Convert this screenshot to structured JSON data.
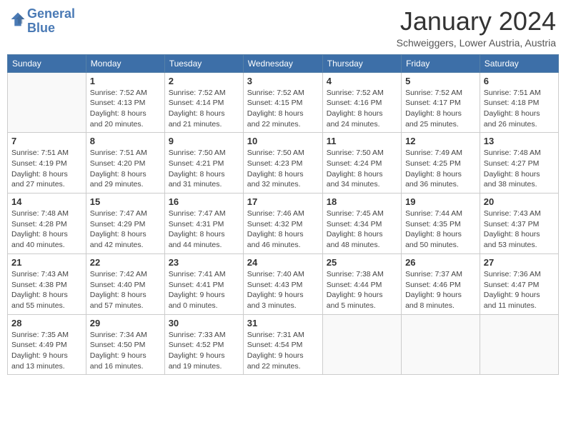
{
  "header": {
    "logo_line1": "General",
    "logo_line2": "Blue",
    "month": "January 2024",
    "location": "Schweiggers, Lower Austria, Austria"
  },
  "weekdays": [
    "Sunday",
    "Monday",
    "Tuesday",
    "Wednesday",
    "Thursday",
    "Friday",
    "Saturday"
  ],
  "weeks": [
    [
      {
        "day": "",
        "info": ""
      },
      {
        "day": "1",
        "info": "Sunrise: 7:52 AM\nSunset: 4:13 PM\nDaylight: 8 hours\nand 20 minutes."
      },
      {
        "day": "2",
        "info": "Sunrise: 7:52 AM\nSunset: 4:14 PM\nDaylight: 8 hours\nand 21 minutes."
      },
      {
        "day": "3",
        "info": "Sunrise: 7:52 AM\nSunset: 4:15 PM\nDaylight: 8 hours\nand 22 minutes."
      },
      {
        "day": "4",
        "info": "Sunrise: 7:52 AM\nSunset: 4:16 PM\nDaylight: 8 hours\nand 24 minutes."
      },
      {
        "day": "5",
        "info": "Sunrise: 7:52 AM\nSunset: 4:17 PM\nDaylight: 8 hours\nand 25 minutes."
      },
      {
        "day": "6",
        "info": "Sunrise: 7:51 AM\nSunset: 4:18 PM\nDaylight: 8 hours\nand 26 minutes."
      }
    ],
    [
      {
        "day": "7",
        "info": "Sunrise: 7:51 AM\nSunset: 4:19 PM\nDaylight: 8 hours\nand 27 minutes."
      },
      {
        "day": "8",
        "info": "Sunrise: 7:51 AM\nSunset: 4:20 PM\nDaylight: 8 hours\nand 29 minutes."
      },
      {
        "day": "9",
        "info": "Sunrise: 7:50 AM\nSunset: 4:21 PM\nDaylight: 8 hours\nand 31 minutes."
      },
      {
        "day": "10",
        "info": "Sunrise: 7:50 AM\nSunset: 4:23 PM\nDaylight: 8 hours\nand 32 minutes."
      },
      {
        "day": "11",
        "info": "Sunrise: 7:50 AM\nSunset: 4:24 PM\nDaylight: 8 hours\nand 34 minutes."
      },
      {
        "day": "12",
        "info": "Sunrise: 7:49 AM\nSunset: 4:25 PM\nDaylight: 8 hours\nand 36 minutes."
      },
      {
        "day": "13",
        "info": "Sunrise: 7:48 AM\nSunset: 4:27 PM\nDaylight: 8 hours\nand 38 minutes."
      }
    ],
    [
      {
        "day": "14",
        "info": "Sunrise: 7:48 AM\nSunset: 4:28 PM\nDaylight: 8 hours\nand 40 minutes."
      },
      {
        "day": "15",
        "info": "Sunrise: 7:47 AM\nSunset: 4:29 PM\nDaylight: 8 hours\nand 42 minutes."
      },
      {
        "day": "16",
        "info": "Sunrise: 7:47 AM\nSunset: 4:31 PM\nDaylight: 8 hours\nand 44 minutes."
      },
      {
        "day": "17",
        "info": "Sunrise: 7:46 AM\nSunset: 4:32 PM\nDaylight: 8 hours\nand 46 minutes."
      },
      {
        "day": "18",
        "info": "Sunrise: 7:45 AM\nSunset: 4:34 PM\nDaylight: 8 hours\nand 48 minutes."
      },
      {
        "day": "19",
        "info": "Sunrise: 7:44 AM\nSunset: 4:35 PM\nDaylight: 8 hours\nand 50 minutes."
      },
      {
        "day": "20",
        "info": "Sunrise: 7:43 AM\nSunset: 4:37 PM\nDaylight: 8 hours\nand 53 minutes."
      }
    ],
    [
      {
        "day": "21",
        "info": "Sunrise: 7:43 AM\nSunset: 4:38 PM\nDaylight: 8 hours\nand 55 minutes."
      },
      {
        "day": "22",
        "info": "Sunrise: 7:42 AM\nSunset: 4:40 PM\nDaylight: 8 hours\nand 57 minutes."
      },
      {
        "day": "23",
        "info": "Sunrise: 7:41 AM\nSunset: 4:41 PM\nDaylight: 9 hours\nand 0 minutes."
      },
      {
        "day": "24",
        "info": "Sunrise: 7:40 AM\nSunset: 4:43 PM\nDaylight: 9 hours\nand 3 minutes."
      },
      {
        "day": "25",
        "info": "Sunrise: 7:38 AM\nSunset: 4:44 PM\nDaylight: 9 hours\nand 5 minutes."
      },
      {
        "day": "26",
        "info": "Sunrise: 7:37 AM\nSunset: 4:46 PM\nDaylight: 9 hours\nand 8 minutes."
      },
      {
        "day": "27",
        "info": "Sunrise: 7:36 AM\nSunset: 4:47 PM\nDaylight: 9 hours\nand 11 minutes."
      }
    ],
    [
      {
        "day": "28",
        "info": "Sunrise: 7:35 AM\nSunset: 4:49 PM\nDaylight: 9 hours\nand 13 minutes."
      },
      {
        "day": "29",
        "info": "Sunrise: 7:34 AM\nSunset: 4:50 PM\nDaylight: 9 hours\nand 16 minutes."
      },
      {
        "day": "30",
        "info": "Sunrise: 7:33 AM\nSunset: 4:52 PM\nDaylight: 9 hours\nand 19 minutes."
      },
      {
        "day": "31",
        "info": "Sunrise: 7:31 AM\nSunset: 4:54 PM\nDaylight: 9 hours\nand 22 minutes."
      },
      {
        "day": "",
        "info": ""
      },
      {
        "day": "",
        "info": ""
      },
      {
        "day": "",
        "info": ""
      }
    ]
  ]
}
